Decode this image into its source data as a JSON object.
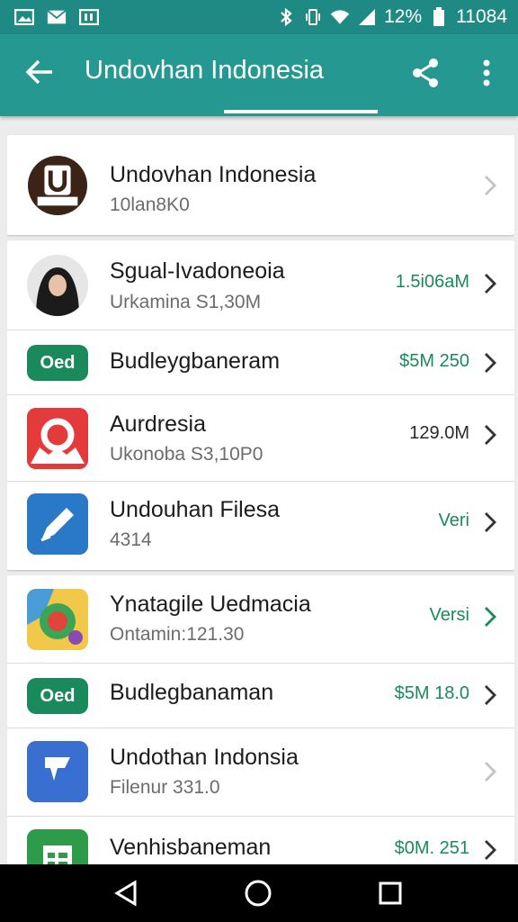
{
  "status_bar": {
    "battery": "12%",
    "time": "11084"
  },
  "appbar": {
    "title": "Undovhan Indonesia"
  },
  "colors": {
    "primary": "#259892",
    "status": "#1f8a84",
    "value_green": "#1a8a5c",
    "badge_green": "#1a8a5c"
  },
  "list_group_1": [
    {
      "title": "Undovhan Indonesia",
      "subtitle": "10lan8K0",
      "value": "",
      "icon": "u-badge-logo",
      "chevron_muted": true
    }
  ],
  "list_group_2": [
    {
      "title": "Sgual-Ivadoneoia",
      "subtitle": "Urkamina S1,30M",
      "value": "1.5i06аM",
      "icon": "user-avatar-icon",
      "value_color": "green"
    },
    {
      "title": "Budleygbaneram",
      "subtitle": "",
      "value": "$5M 250",
      "badge": "Oed",
      "icon": "badge",
      "value_color": "green"
    },
    {
      "title": "Aurdresia",
      "subtitle": "Ukonoba S3,10P0",
      "value": "129.0M",
      "icon": "red-camera-icon",
      "value_color": "dark"
    },
    {
      "title": "Undouhan Filesa",
      "subtitle": "4314",
      "value": "Veri",
      "icon": "blue-pen-icon",
      "value_color": "green"
    }
  ],
  "list_group_3": [
    {
      "title": "Ynatagile Uedmacia",
      "subtitle": "Ontamin:121.30",
      "value": "Versi",
      "icon": "map-pin-icon",
      "value_color": "green"
    },
    {
      "title": "Budlegbanaman",
      "subtitle": "",
      "value": "$5M 18.0",
      "badge": "Oed",
      "icon": "badge",
      "value_color": "green"
    },
    {
      "title": "Undothan Indonsia",
      "subtitle": "Filenur 331.0",
      "value": "",
      "icon": "blue-flag-icon",
      "chevron_muted": true
    },
    {
      "title": "Venhisbaneman",
      "subtitle": "",
      "value": "$0M. 251",
      "icon": "green-sheet-icon",
      "value_color": "green"
    }
  ]
}
